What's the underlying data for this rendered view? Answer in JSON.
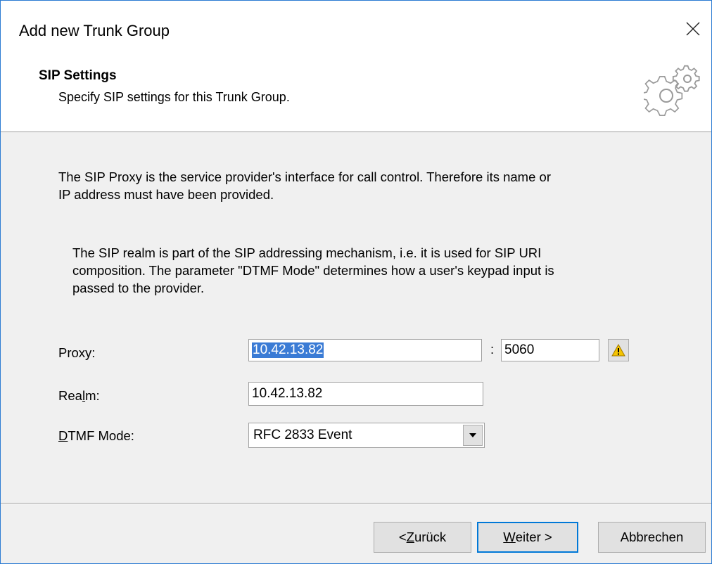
{
  "window": {
    "title": "Add new Trunk Group",
    "close_icon": "close-icon"
  },
  "header": {
    "title": "SIP Settings",
    "subtitle": "Specify SIP settings for this Trunk Group.",
    "icon": "gear-icon"
  },
  "content": {
    "paragraph1_line1": "The SIP Proxy is the service provider's interface for call control. Therefore its name or",
    "paragraph1_line2": "IP address must have been provided.",
    "paragraph2_line1": "The SIP realm is part of the SIP addressing mechanism, i.e. it is used for SIP URI",
    "paragraph2_line2": "composition. The parameter \"DTMF Mode\" determines how a user's keypad input is",
    "paragraph2_line3": "passed to the provider."
  },
  "form": {
    "proxy_label": "Proxy:",
    "proxy_value": "10.42.13.82",
    "port_separator": ":",
    "port_value": "5060",
    "warning_icon": "warning-icon",
    "realm_label_pre": "Rea",
    "realm_label_accel": "l",
    "realm_label_post": "m:",
    "realm_value": "10.42.13.82",
    "dtmf_label_accel": "D",
    "dtmf_label_post": "TMF Mode:",
    "dtmf_value": "RFC 2833 Event"
  },
  "buttons": {
    "back_pre": "< ",
    "back_accel": "Z",
    "back_post": "urück",
    "next_accel": "W",
    "next_post": "eiter >",
    "cancel": "Abbrechen"
  },
  "colors": {
    "accent": "#0078d7",
    "selection": "#3a7bd5",
    "warning": "#f5c400"
  }
}
